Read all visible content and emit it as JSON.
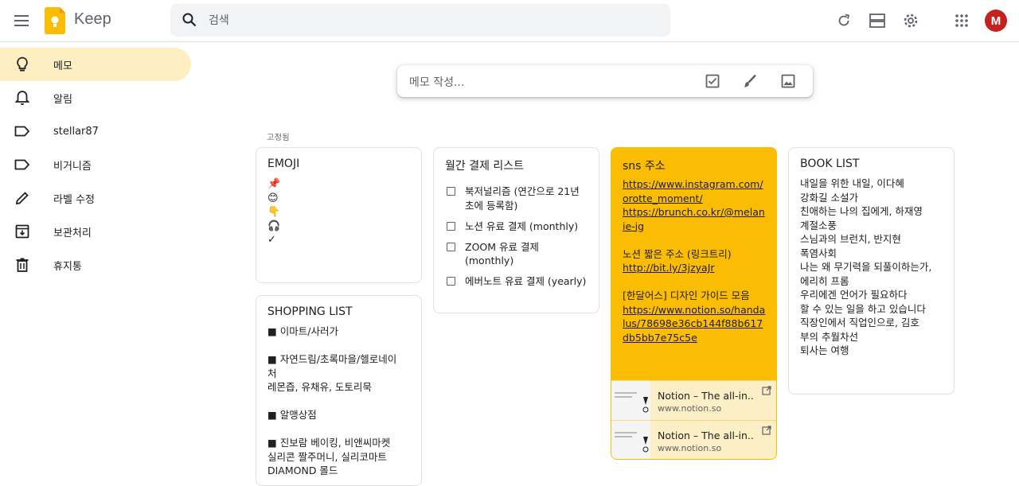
{
  "app": {
    "name": "Keep"
  },
  "search": {
    "placeholder": "검색"
  },
  "user": {
    "initial": "M"
  },
  "sidebar": {
    "items": [
      {
        "label": "메모",
        "icon": "lightbulb-icon",
        "active": true
      },
      {
        "label": "알림",
        "icon": "bell-icon"
      },
      {
        "label": "stellar87",
        "icon": "label-icon"
      },
      {
        "label": "비거니즘",
        "icon": "label-icon"
      },
      {
        "label": "라벨 수정",
        "icon": "pencil-icon"
      },
      {
        "label": "보관처리",
        "icon": "archive-icon"
      },
      {
        "label": "휴지통",
        "icon": "trash-icon"
      }
    ]
  },
  "composer": {
    "placeholder": "메모 작성..."
  },
  "pinned_label": "고정됨",
  "notes": {
    "emoji": {
      "title": "EMOJI",
      "lines": [
        "📌",
        "😊",
        "👇",
        "🎧",
        "✓"
      ]
    },
    "shopping": {
      "title": "SHOPPING LIST",
      "lines": [
        "■ 이마트/사러가",
        "",
        "■ 자연드림/초록마을/헬로네이",
        "처",
        "레몬즙, 유채유, 도토리묵",
        "",
        "■ 알맹상점",
        "",
        "■ 진보람 베이킹, 비앤씨마켓",
        "실리콘 짤주머니, 실리코마트",
        "DIAMOND 몰드"
      ]
    },
    "payments": {
      "title": "월간 결제 리스트",
      "items": [
        "북저널리즘 (연간으로 21년 초에 등록함)",
        "노션 유료 결제 (monthly)",
        "ZOOM 유료 결제 (monthly)",
        "에버노트 유료 결제 (yearly)"
      ]
    },
    "sns": {
      "title": "sns 주소",
      "link1": "https://www.instagram.com/orotte_moment/",
      "link2": "https://brunch.co.kr/@melanie-jg",
      "label2": "노션 짧은 주소 (링크트리)",
      "link3": "http://bit.ly/3jzyaJr",
      "label3": "[한달어스] 디자인 가이드 모음",
      "link4": "https://www.notion.so/handalus/78698e36cb144f88b617db5bb7e75c5e",
      "cards": [
        {
          "title": "Notion – The all-in...",
          "url": "www.notion.so"
        },
        {
          "title": "Notion – The all-in...",
          "url": "www.notion.so"
        }
      ]
    },
    "books": {
      "title": "BOOK LIST",
      "lines": [
        "내일을 위한 내일, 이다혜",
        "강화길 소설가",
        "친애하는 나의 집에게, 하재영",
        "계절소풍",
        "스님과의 브런치, 반지현",
        "폭염사회",
        "나는 왜 무기력을 되풀이하는가,",
        "에리히 프롬",
        "우리에겐 언어가 필요하다",
        "할 수 있는 일을 하고 있습니다",
        "직장인에서 직업인으로, 김호",
        "부의 추월차선",
        "퇴사는 여행"
      ]
    }
  },
  "colors": {
    "yellow_note": "#fbbc04",
    "active_nav": "#feefc3",
    "avatar": "#c5221f",
    "logo": "#fbbc04"
  }
}
